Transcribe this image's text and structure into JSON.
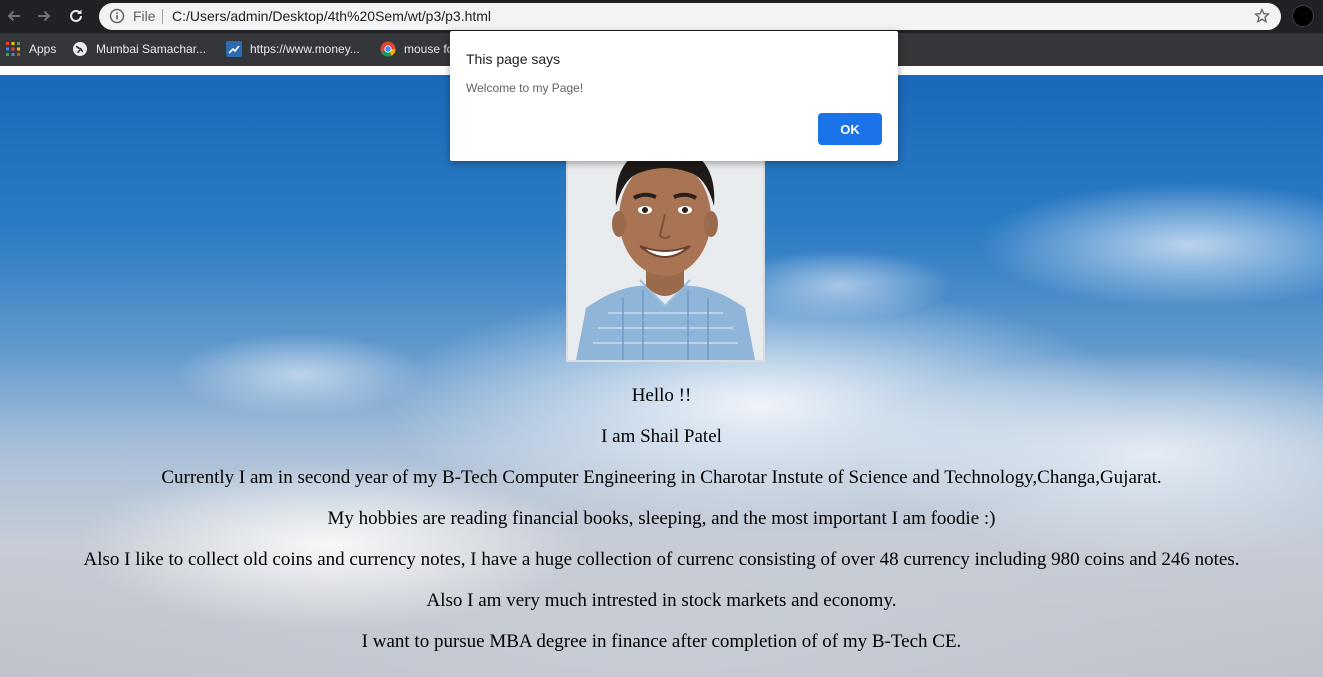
{
  "browser": {
    "omnibox": {
      "scheme_label": "File",
      "url": "C:/Users/admin/Desktop/4th%20Sem/wt/p3/p3.html"
    },
    "bookmarks": [
      {
        "label": "Apps",
        "icon": "apps-grid-icon"
      },
      {
        "label": "Mumbai Samachar...",
        "icon": "globe-icon"
      },
      {
        "label": "https://www.money...",
        "icon": "moneycontrol-icon"
      },
      {
        "label": "mouse fo",
        "icon": "chrome-icon"
      }
    ]
  },
  "page": {
    "paragraphs": [
      "Hello !!",
      "I am Shail Patel",
      "Currently I am in second year of my B-Tech Computer Engineering in Charotar Instute of Science and Technology,Changa,Gujarat.",
      "My hobbies are reading financial books, sleeping, and the most important I am foodie :)",
      "Also I like to collect old coins and currency notes, I have a huge collection of currenc consisting of over 48 currency including 980 coins and 246 notes.",
      "Also I am very much intrested in stock markets and economy.",
      "I want to pursue MBA degree in finance after completion of of my B-Tech CE."
    ]
  },
  "dialog": {
    "title": "This page says",
    "message": "Welcome to my Page!",
    "ok_label": "OK"
  },
  "colors": {
    "accent": "#1a73e8",
    "chrome_dark": "#202124",
    "bookmarks_bar": "#35363a"
  }
}
